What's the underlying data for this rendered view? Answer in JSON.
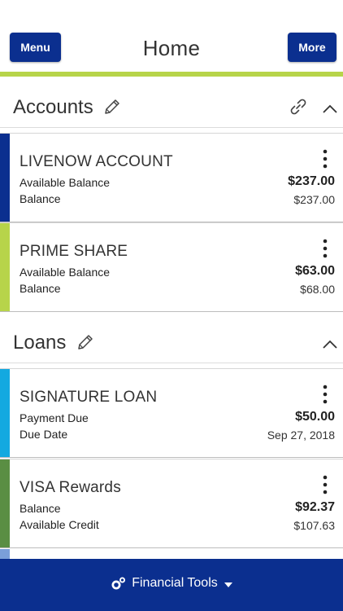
{
  "header": {
    "menu_label": "Menu",
    "title": "Home",
    "more_label": "More"
  },
  "colors": {
    "primary": "#0b2f8f",
    "accent_green": "#b7d44a",
    "livenow_bar": "#0b2f8f",
    "prime_bar": "#b7d44a",
    "signature_bar": "#13a9e0",
    "visa_bar": "#5a8e43"
  },
  "accounts": {
    "title": "Accounts",
    "items": [
      {
        "name": "LIVENOW ACCOUNT",
        "label1": "Available Balance",
        "value1": "$237.00",
        "label2": "Balance",
        "value2": "$237.00"
      },
      {
        "name": "PRIME SHARE",
        "label1": "Available Balance",
        "value1": "$63.00",
        "label2": "Balance",
        "value2": "$68.00"
      }
    ]
  },
  "loans": {
    "title": "Loans",
    "items": [
      {
        "name": "SIGNATURE LOAN",
        "label1": "Payment Due",
        "value1": "$50.00",
        "label2": "Due Date",
        "value2": "Sep 27, 2018"
      },
      {
        "name": "VISA Rewards",
        "label1": "Balance",
        "value1": "$92.37",
        "label2": "Available Credit",
        "value2": "$107.63"
      }
    ]
  },
  "footer": {
    "label": "Financial Tools"
  }
}
